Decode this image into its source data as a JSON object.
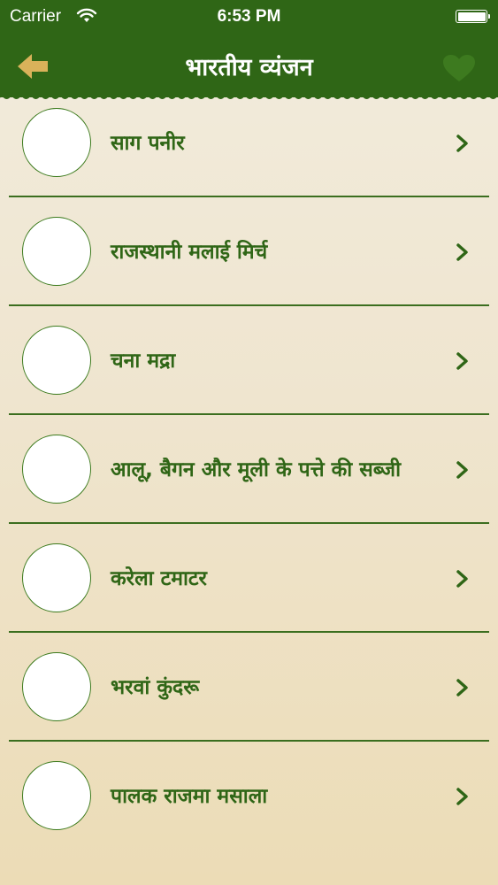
{
  "status_bar": {
    "carrier": "Carrier",
    "time": "6:53 PM",
    "icons": [
      "wifi-icon",
      "battery-icon"
    ]
  },
  "nav": {
    "title": "भारतीय व्यंजन",
    "back_icon": "arrow-left-icon",
    "favorite_icon": "heart-icon"
  },
  "recipes": [
    {
      "title": "साग पनीर"
    },
    {
      "title": "राजस्थानी मलाई मिर्च"
    },
    {
      "title": "चना मद्रा"
    },
    {
      "title": "आलू, बैगन और मूली के पत्ते की सब्जी"
    },
    {
      "title": "करेला टमाटर"
    },
    {
      "title": "भरवां कुंदरू"
    },
    {
      "title": "पालक राजमा मसाला"
    }
  ],
  "colors": {
    "nav_green": "#2f6616",
    "text_green": "#2f6616",
    "back_arrow": "#d9b25a",
    "background": "#efe5cf"
  }
}
